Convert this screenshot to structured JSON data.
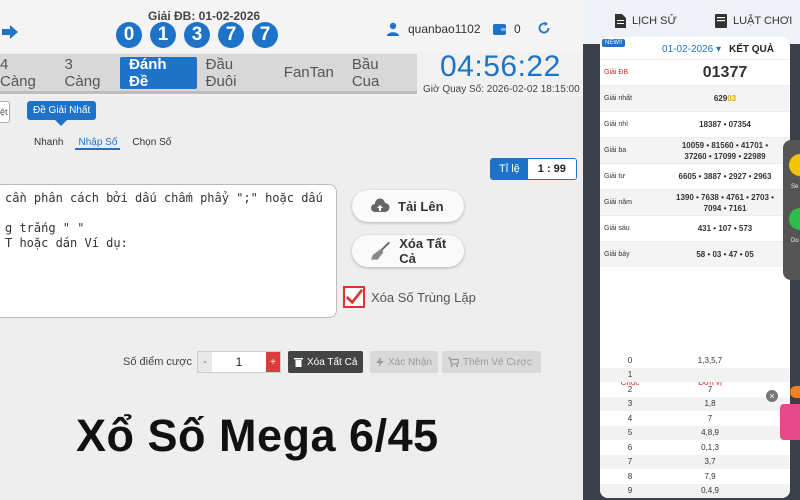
{
  "header": {
    "giai_db_label": "Giải ĐB: 01-02-2026",
    "balls": [
      "0",
      "1",
      "3",
      "7",
      "7"
    ],
    "username": "quanbao1102",
    "balance": "0"
  },
  "tabs": [
    {
      "label": "4 Càng",
      "active": false
    },
    {
      "label": "3 Càng",
      "active": false
    },
    {
      "label": "Đánh Đề",
      "active": true
    },
    {
      "label": "Đầu Đuôi",
      "active": false
    },
    {
      "label": "FanTan",
      "active": false
    },
    {
      "label": "Bầu Cua",
      "active": false
    }
  ],
  "timer": {
    "value": "04:56:22",
    "quay_label": "Giờ Quay Số: 2026-02-02 18:15:00"
  },
  "bet": {
    "left_tab_partial": "ệt",
    "sub_tab": "Đề Giải Nhất",
    "modes": [
      {
        "label": "Nhanh",
        "active": false
      },
      {
        "label": "Nhập Số",
        "active": true
      },
      {
        "label": "Chọn Số",
        "active": false
      }
    ],
    "ti_le_label": "Tỉ lệ",
    "ti_le_value": "1 : 99",
    "textarea_text": "cần phân cách bởi dấu chấm phẩy \";\" hoặc dấu\n\ng trắng \" \"\nT hoặc dán Ví dụ:",
    "upload_label": "Tải Lên",
    "clear_all_label": "Xóa Tất Cả",
    "dedupe_label": "Xóa Số Trùng Lặp",
    "points_label": "Số điểm cược",
    "stepper_minus": "-",
    "stepper_value": "1",
    "stepper_plus": "+",
    "btn_clear": "Xóa Tất Cả",
    "btn_confirm": "Xác Nhận",
    "btn_add": "Thêm Vé Cược"
  },
  "overlay_title": "Xổ Số Mega 6/45",
  "right_panel": {
    "history_label": "LỊCH SỬ",
    "rules_label": "LUẬT CHƠI",
    "new_badge": "NEW!!",
    "date": "01-02-2026",
    "result_title": "KẾT QUẢ",
    "prizes": [
      {
        "name": "Giải ĐB",
        "lines": [
          "01377"
        ]
      },
      {
        "name": "Giải nhất",
        "lines": [
          "62903"
        ]
      },
      {
        "name": "Giải nhì",
        "lines": [
          "18387 • 07354"
        ]
      },
      {
        "name": "Giải ba",
        "lines": [
          "10059 • 81560 • 41701 •",
          "37260 • 17099 • 22989"
        ]
      },
      {
        "name": "Giải tư",
        "lines": [
          "6605 • 3887 • 2927 • 2963"
        ]
      },
      {
        "name": "Giải năm",
        "lines": [
          "1390 • 7638 • 4761 • 2703 •",
          "7094 • 7161"
        ]
      },
      {
        "name": "Giải sáu",
        "lines": [
          "431 • 107 • 573"
        ]
      },
      {
        "name": "Giải bảy",
        "lines": [
          "58 • 03 • 47 • 05"
        ]
      }
    ],
    "loto_head": [
      "Chục",
      "Đơn vị"
    ],
    "loto": [
      [
        "0",
        "1,3,5,7"
      ],
      [
        "1",
        ""
      ],
      [
        "2",
        "7"
      ],
      [
        "3",
        "1,8"
      ],
      [
        "4",
        "7"
      ],
      [
        "5",
        "4,8,9"
      ],
      [
        "6",
        "0,1,3"
      ],
      [
        "7",
        "3,7"
      ],
      [
        "8",
        "7,9"
      ],
      [
        "9",
        "0,4,9"
      ]
    ],
    "side_labels": [
      "Se",
      "Do"
    ]
  },
  "colors": {
    "primary": "#1e73c9",
    "red": "#d62b2b",
    "highlight": "#e8a317",
    "panel": "#3b3f4a"
  }
}
